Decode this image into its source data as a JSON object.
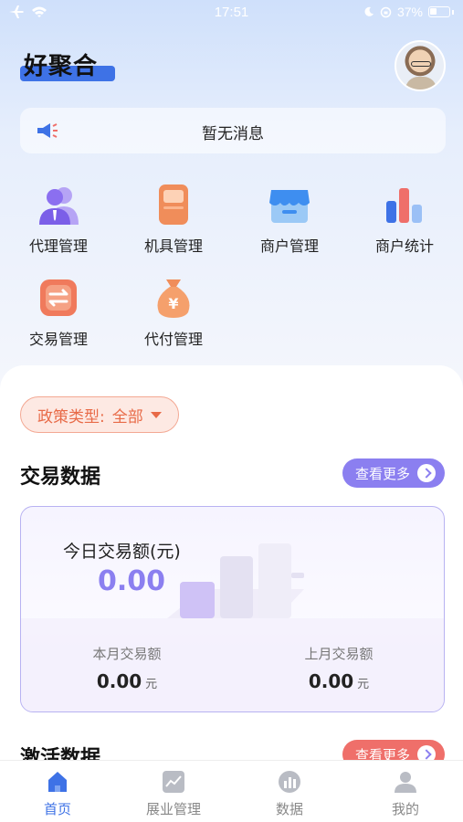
{
  "status_bar": {
    "time": "17:51",
    "battery": "37%"
  },
  "header": {
    "app_title": "好聚合"
  },
  "notice": {
    "text": "暂无消息"
  },
  "menu": [
    {
      "label": "代理管理",
      "icon": "agent-icon"
    },
    {
      "label": "机具管理",
      "icon": "device-icon"
    },
    {
      "label": "商户管理",
      "icon": "shop-icon"
    },
    {
      "label": "商户统计",
      "icon": "bar-chart-icon"
    },
    {
      "label": "交易管理",
      "icon": "exchange-icon"
    },
    {
      "label": "代付管理",
      "icon": "money-bag-icon"
    }
  ],
  "policy_filter": {
    "label": "政策类型:",
    "value": "全部"
  },
  "trade": {
    "title": "交易数据",
    "more": "查看更多",
    "today_label": "今日交易额(元)",
    "today_value": "0.00",
    "month_label": "本月交易额",
    "month_value": "0.00",
    "month_unit": "元",
    "last_month_label": "上月交易额",
    "last_month_value": "0.00",
    "last_month_unit": "元"
  },
  "activation": {
    "title": "激活数据",
    "more": "查看更多"
  },
  "tabs": [
    {
      "label": "首页",
      "icon": "home-icon",
      "active": true
    },
    {
      "label": "展业管理",
      "icon": "trend-icon",
      "active": false
    },
    {
      "label": "数据",
      "icon": "data-icon",
      "active": false
    },
    {
      "label": "我的",
      "icon": "user-icon",
      "active": false
    }
  ],
  "colors": {
    "primary": "#3e72e6",
    "purple": "#8b7ff0",
    "coral": "#ef6f6a",
    "orange": "#e86a47"
  }
}
